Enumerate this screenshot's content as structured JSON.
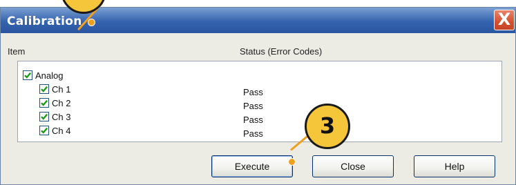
{
  "window": {
    "title": "Calibration",
    "close_glyph": "X"
  },
  "columns": {
    "item": "Item",
    "status": "Status (Error Codes)"
  },
  "tree": {
    "parent": {
      "label": "Analog",
      "checked": true
    },
    "children": [
      {
        "label": "Ch 1",
        "status": "Pass",
        "checked": true
      },
      {
        "label": "Ch 2",
        "status": "Pass",
        "checked": true
      },
      {
        "label": "Ch 3",
        "status": "Pass",
        "checked": true
      },
      {
        "label": "Ch 4",
        "status": "Pass",
        "checked": true
      }
    ]
  },
  "buttons": {
    "execute": "Execute",
    "close": "Close",
    "help": "Help"
  },
  "callout": {
    "step_number": "3",
    "color": "#f6c63a",
    "leader_color": "#f0a020"
  },
  "colors": {
    "titlebar": "#3563ad",
    "close_button": "#d4502f",
    "checkmark": "#1a9a1a"
  }
}
